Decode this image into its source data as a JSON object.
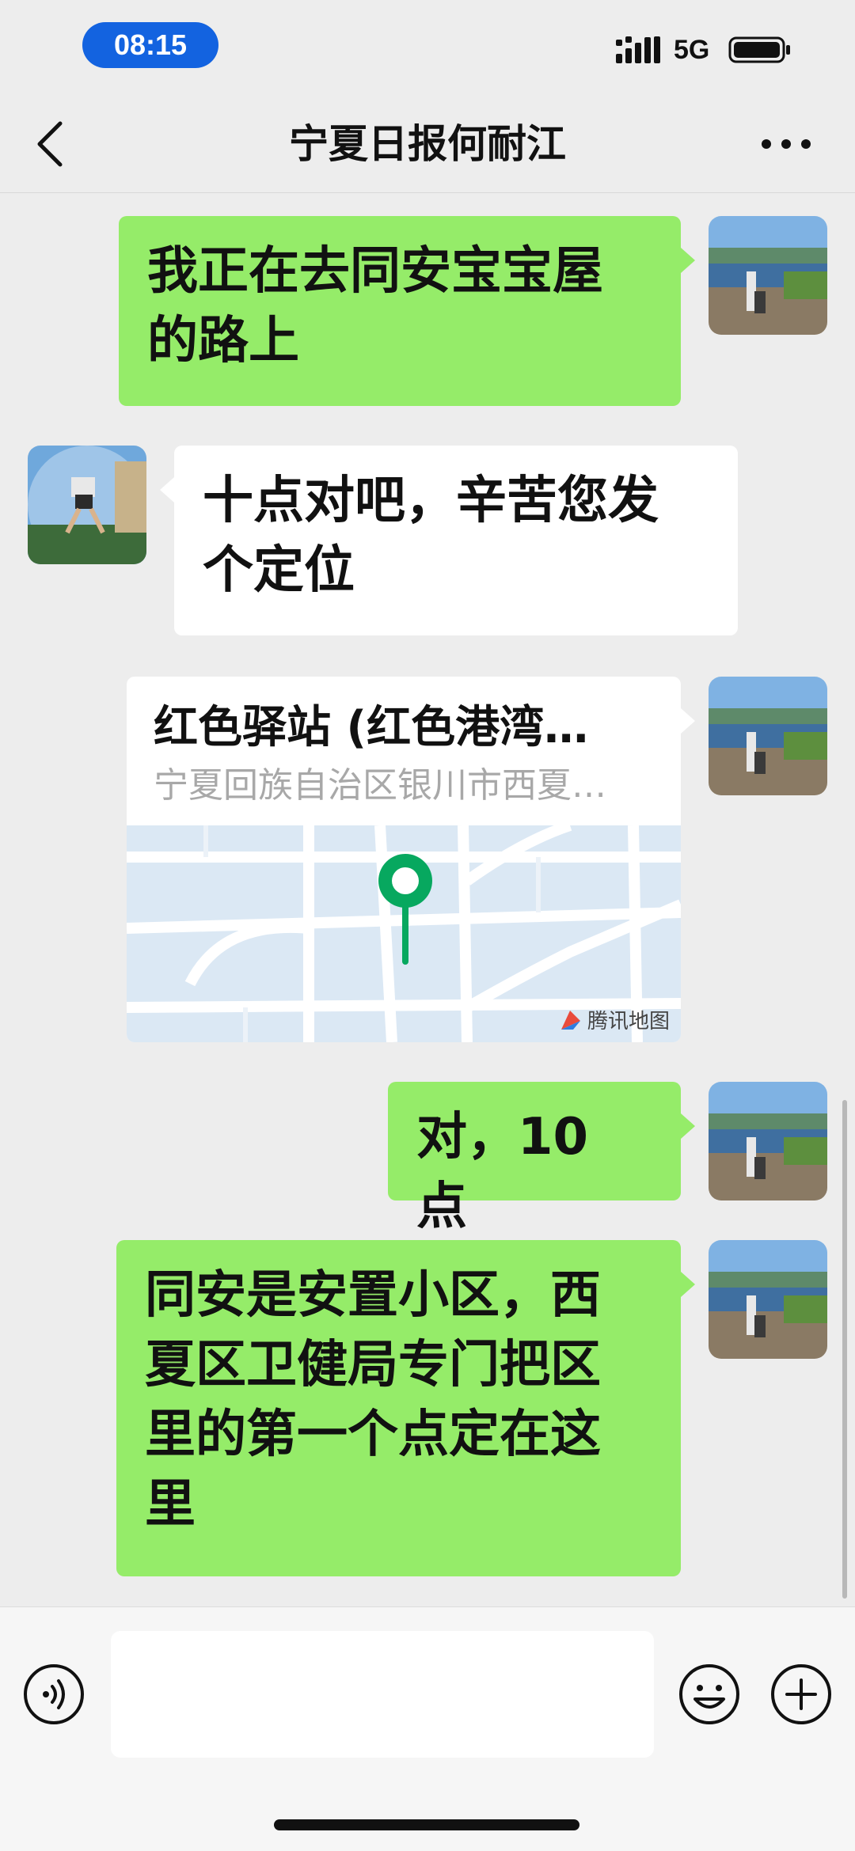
{
  "status_bar": {
    "time": "08:15",
    "network": "5G"
  },
  "nav": {
    "title": "宁夏日报何耐江"
  },
  "messages": [
    {
      "direction": "out",
      "lines": [
        "我正在去同安宝宝屋",
        "的路上"
      ]
    },
    {
      "direction": "in",
      "lines": [
        "十点对吧，辛苦您发",
        "个定位"
      ]
    },
    {
      "direction": "out",
      "type": "location",
      "title": "红色驿站 (红色港湾…",
      "address": "宁夏回族自治区银川市西夏…",
      "map_provider": "腾讯地图"
    },
    {
      "direction": "out",
      "lines": [
        "对，10 点"
      ]
    },
    {
      "direction": "out",
      "lines": [
        "同安是安置小区，西",
        "夏区卫健局专门把区",
        "里的第一个点定在这",
        "里"
      ]
    }
  ],
  "input": {
    "value": "",
    "placeholder": ""
  },
  "icons": {
    "back": "chevron-left-icon",
    "more": "more-dots-icon",
    "voice": "voice-icon",
    "emoji": "emoji-icon",
    "add": "plus-icon"
  },
  "colors": {
    "outgoing_bubble": "#95ec69",
    "incoming_bubble": "#ffffff",
    "background": "#ededed",
    "time_pill": "#1363e0",
    "map_pin": "#07a85f"
  }
}
